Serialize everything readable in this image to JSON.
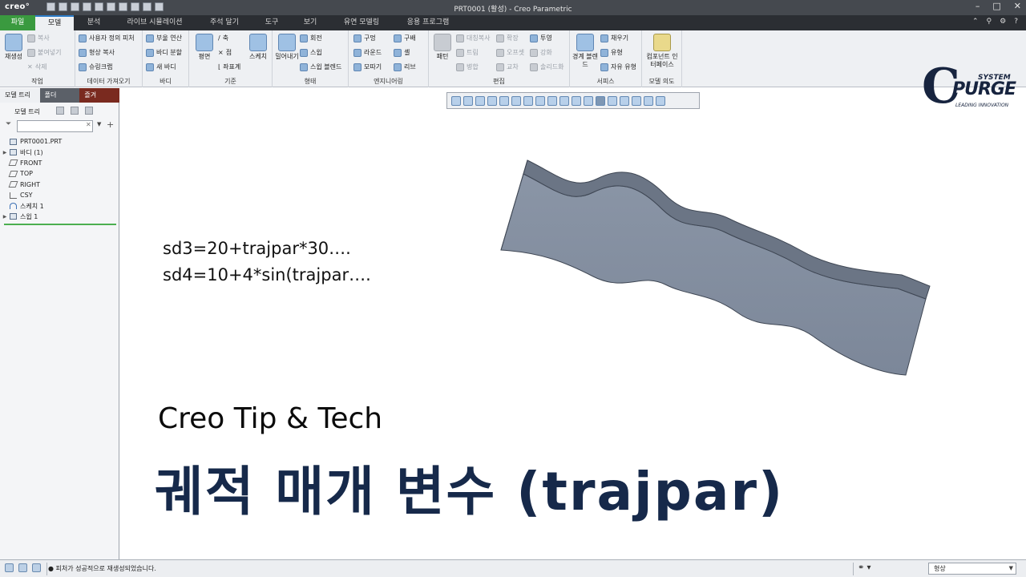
{
  "window": {
    "app_logo": "creo°",
    "title": "PRT0001 (활성) - Creo Parametric",
    "controls": [
      "–",
      "□",
      "✕"
    ]
  },
  "tabs": [
    {
      "label": "파일"
    },
    {
      "label": "모델"
    },
    {
      "label": "분석"
    },
    {
      "label": "라이브 시뮬레이션"
    },
    {
      "label": "주석 달기"
    },
    {
      "label": "도구"
    },
    {
      "label": "보기"
    },
    {
      "label": "유연 모델링"
    },
    {
      "label": "응용 프로그램"
    }
  ],
  "ribbon": {
    "operations": {
      "group": "작업",
      "regenerate": "재생성",
      "copy": "복사",
      "paste": "붙여넣기",
      "delete": "삭제"
    },
    "get_data": {
      "group": "데이터 가져오기",
      "udf": "사용자 정의 피처",
      "copy_geom": "형상 복사",
      "shrinkwrap": "슈링크랩"
    },
    "body": {
      "group": "바디",
      "boolean": "부울 연산",
      "split_body": "바디 분할",
      "new_body": "새 바디"
    },
    "datum": {
      "group": "기준",
      "plane": "평면",
      "axis": "축",
      "point": "점",
      "csys": "좌표계",
      "sketch": "스케치"
    },
    "shapes": {
      "group": "형태",
      "extrude": "밀어내기",
      "revolve": "회전",
      "sweep": "스윕",
      "swept_blend": "스윕 블렌드"
    },
    "engineering": {
      "group": "엔지니어링",
      "hole": "구멍",
      "round": "라운드",
      "chamfer": "모따기",
      "draft": "구배",
      "shell": "셸",
      "rib": "리브"
    },
    "editing": {
      "group": "편집",
      "pattern": "패턴",
      "mirror": "대칭복사",
      "trim": "트림",
      "merge": "병합",
      "extend": "확장",
      "offset": "오프셋",
      "intersect": "교차",
      "project": "투영",
      "thicken": "강화",
      "solidify": "솔리드화"
    },
    "surfaces": {
      "group": "서피스",
      "boundary_blend": "경계 블렌드",
      "fill": "채우기",
      "style": "유형",
      "freestyle": "자유 유형"
    },
    "model_intent": {
      "group": "모델 의도",
      "component_interface": "컴포넌트 인터페이스"
    }
  },
  "brand": {
    "word": "PURGE",
    "system": "SYSTEM",
    "tagline": "LEADING INNOVATION"
  },
  "left_panel": {
    "tabs": [
      "모델 트리",
      "폴더",
      "즐겨"
    ],
    "title": "모델 트리",
    "filter_placeholder": "",
    "tree": [
      {
        "label": "PRT0001.PRT",
        "icon": "part-icon",
        "expand": ""
      },
      {
        "label": "바디 (1)",
        "icon": "body-icon",
        "expand": "▶"
      },
      {
        "label": "FRONT",
        "icon": "plane-icon",
        "expand": ""
      },
      {
        "label": "TOP",
        "icon": "plane-icon",
        "expand": ""
      },
      {
        "label": "RIGHT",
        "icon": "plane-icon",
        "expand": ""
      },
      {
        "label": "CSY",
        "icon": "csys-icon",
        "expand": ""
      },
      {
        "label": "스케치 1",
        "icon": "sketch-icon",
        "expand": ""
      },
      {
        "label": "스윕 1",
        "icon": "sweep-icon",
        "expand": "▶"
      }
    ]
  },
  "canvas": {
    "relations": [
      "sd3=20+trajpar*30….",
      "sd4=10+4*sin(trajpar…."
    ],
    "subtitle": "Creo Tip & Tech",
    "headline": "궤적 매개 변수 (trajpar)"
  },
  "status": {
    "message": "● 피처가 성공적으로 재생성되었습니다.",
    "filter_value": "형상"
  }
}
